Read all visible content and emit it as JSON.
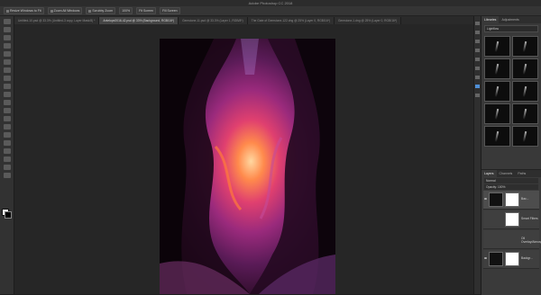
{
  "app": {
    "title": "Adobe Photoshop CC 2018"
  },
  "options_bar": {
    "items": [
      "Resize Windows to Fit",
      "Zoom All Windows",
      "Scrubby Zoom",
      "100%",
      "Fit Screen",
      "Fill Screen"
    ]
  },
  "tabs": [
    {
      "label": "Untitled-10.psd @ 33.3% (Untitled-3 copy, Layer Mask/8) *",
      "active": false
    },
    {
      "label": "Antelope2016-42.psd @ 33% (Background, RGB/16*)",
      "active": true
    },
    {
      "label": "Gemstone-11.psd @ 33.3% (Layer 1, RGB/8*)",
      "active": false
    },
    {
      "label": "The Gate of Gemstone-122.dng @ 25% (Layer 0, RGB/16*)",
      "active": false
    },
    {
      "label": "Gemstone-1.dng @ 25% (Layer 0, RGB/16*)",
      "active": false
    }
  ],
  "right_panel": {
    "tabs": [
      {
        "label": "Libraries",
        "active": true
      },
      {
        "label": "Adjustments",
        "active": false
      }
    ],
    "library_dropdown": "Lightflow",
    "layers_tabs": [
      {
        "label": "Layers",
        "active": true
      },
      {
        "label": "Channels",
        "active": false
      },
      {
        "label": "Paths",
        "active": false
      }
    ],
    "blend_mode": "Normal",
    "opacity": "Opacity: 100%",
    "layer_rows": [
      {
        "name": "Bac...",
        "selected": true
      },
      {
        "name": "Smart Filters",
        "selected": false
      },
      {
        "name": "Oil Overlay/Atmosphere",
        "selected": false
      },
      {
        "name": "Backgr...",
        "selected": false
      }
    ]
  },
  "colors": {
    "accent": "#4f8fd6",
    "panel_bg": "#393939",
    "workspace_bg": "#262626"
  }
}
